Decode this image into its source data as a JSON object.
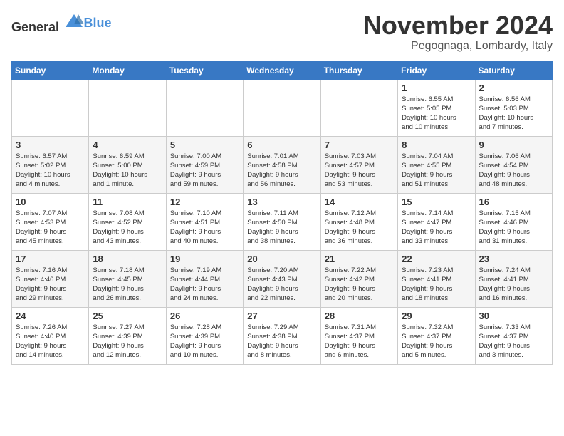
{
  "logo": {
    "general": "General",
    "blue": "Blue"
  },
  "title": "November 2024",
  "location": "Pegognaga, Lombardy, Italy",
  "days_of_week": [
    "Sunday",
    "Monday",
    "Tuesday",
    "Wednesday",
    "Thursday",
    "Friday",
    "Saturday"
  ],
  "weeks": [
    [
      {
        "day": "",
        "info": ""
      },
      {
        "day": "",
        "info": ""
      },
      {
        "day": "",
        "info": ""
      },
      {
        "day": "",
        "info": ""
      },
      {
        "day": "",
        "info": ""
      },
      {
        "day": "1",
        "info": "Sunrise: 6:55 AM\nSunset: 5:05 PM\nDaylight: 10 hours\nand 10 minutes."
      },
      {
        "day": "2",
        "info": "Sunrise: 6:56 AM\nSunset: 5:03 PM\nDaylight: 10 hours\nand 7 minutes."
      }
    ],
    [
      {
        "day": "3",
        "info": "Sunrise: 6:57 AM\nSunset: 5:02 PM\nDaylight: 10 hours\nand 4 minutes."
      },
      {
        "day": "4",
        "info": "Sunrise: 6:59 AM\nSunset: 5:00 PM\nDaylight: 10 hours\nand 1 minute."
      },
      {
        "day": "5",
        "info": "Sunrise: 7:00 AM\nSunset: 4:59 PM\nDaylight: 9 hours\nand 59 minutes."
      },
      {
        "day": "6",
        "info": "Sunrise: 7:01 AM\nSunset: 4:58 PM\nDaylight: 9 hours\nand 56 minutes."
      },
      {
        "day": "7",
        "info": "Sunrise: 7:03 AM\nSunset: 4:57 PM\nDaylight: 9 hours\nand 53 minutes."
      },
      {
        "day": "8",
        "info": "Sunrise: 7:04 AM\nSunset: 4:55 PM\nDaylight: 9 hours\nand 51 minutes."
      },
      {
        "day": "9",
        "info": "Sunrise: 7:06 AM\nSunset: 4:54 PM\nDaylight: 9 hours\nand 48 minutes."
      }
    ],
    [
      {
        "day": "10",
        "info": "Sunrise: 7:07 AM\nSunset: 4:53 PM\nDaylight: 9 hours\nand 45 minutes."
      },
      {
        "day": "11",
        "info": "Sunrise: 7:08 AM\nSunset: 4:52 PM\nDaylight: 9 hours\nand 43 minutes."
      },
      {
        "day": "12",
        "info": "Sunrise: 7:10 AM\nSunset: 4:51 PM\nDaylight: 9 hours\nand 40 minutes."
      },
      {
        "day": "13",
        "info": "Sunrise: 7:11 AM\nSunset: 4:50 PM\nDaylight: 9 hours\nand 38 minutes."
      },
      {
        "day": "14",
        "info": "Sunrise: 7:12 AM\nSunset: 4:48 PM\nDaylight: 9 hours\nand 36 minutes."
      },
      {
        "day": "15",
        "info": "Sunrise: 7:14 AM\nSunset: 4:47 PM\nDaylight: 9 hours\nand 33 minutes."
      },
      {
        "day": "16",
        "info": "Sunrise: 7:15 AM\nSunset: 4:46 PM\nDaylight: 9 hours\nand 31 minutes."
      }
    ],
    [
      {
        "day": "17",
        "info": "Sunrise: 7:16 AM\nSunset: 4:46 PM\nDaylight: 9 hours\nand 29 minutes."
      },
      {
        "day": "18",
        "info": "Sunrise: 7:18 AM\nSunset: 4:45 PM\nDaylight: 9 hours\nand 26 minutes."
      },
      {
        "day": "19",
        "info": "Sunrise: 7:19 AM\nSunset: 4:44 PM\nDaylight: 9 hours\nand 24 minutes."
      },
      {
        "day": "20",
        "info": "Sunrise: 7:20 AM\nSunset: 4:43 PM\nDaylight: 9 hours\nand 22 minutes."
      },
      {
        "day": "21",
        "info": "Sunrise: 7:22 AM\nSunset: 4:42 PM\nDaylight: 9 hours\nand 20 minutes."
      },
      {
        "day": "22",
        "info": "Sunrise: 7:23 AM\nSunset: 4:41 PM\nDaylight: 9 hours\nand 18 minutes."
      },
      {
        "day": "23",
        "info": "Sunrise: 7:24 AM\nSunset: 4:41 PM\nDaylight: 9 hours\nand 16 minutes."
      }
    ],
    [
      {
        "day": "24",
        "info": "Sunrise: 7:26 AM\nSunset: 4:40 PM\nDaylight: 9 hours\nand 14 minutes."
      },
      {
        "day": "25",
        "info": "Sunrise: 7:27 AM\nSunset: 4:39 PM\nDaylight: 9 hours\nand 12 minutes."
      },
      {
        "day": "26",
        "info": "Sunrise: 7:28 AM\nSunset: 4:39 PM\nDaylight: 9 hours\nand 10 minutes."
      },
      {
        "day": "27",
        "info": "Sunrise: 7:29 AM\nSunset: 4:38 PM\nDaylight: 9 hours\nand 8 minutes."
      },
      {
        "day": "28",
        "info": "Sunrise: 7:31 AM\nSunset: 4:37 PM\nDaylight: 9 hours\nand 6 minutes."
      },
      {
        "day": "29",
        "info": "Sunrise: 7:32 AM\nSunset: 4:37 PM\nDaylight: 9 hours\nand 5 minutes."
      },
      {
        "day": "30",
        "info": "Sunrise: 7:33 AM\nSunset: 4:37 PM\nDaylight: 9 hours\nand 3 minutes."
      }
    ]
  ]
}
